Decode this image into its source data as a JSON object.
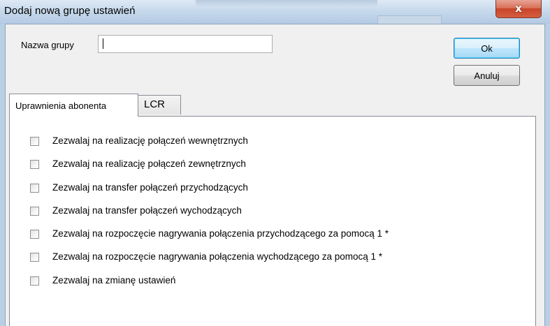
{
  "window": {
    "title": "Dodaj nową grupę ustawień",
    "close_symbol": "x"
  },
  "form": {
    "name_label": "Nazwa grupy",
    "name_value": "",
    "name_placeholder": ""
  },
  "buttons": {
    "ok_label": "Ok",
    "cancel_label": "Anuluj"
  },
  "tabs": [
    {
      "label": "Uprawnienia abonenta",
      "active": true
    },
    {
      "label": "LCR",
      "active": false
    }
  ],
  "permissions": [
    {
      "label": "Zezwalaj na realizację połączeń wewnętrznych",
      "checked": false
    },
    {
      "label": "Zezwalaj na realizację połączeń zewnętrznych",
      "checked": false
    },
    {
      "label": "Zezwalaj na transfer połączeń przychodzących",
      "checked": false
    },
    {
      "label": "Zezwalaj na transfer połączeń wychodzących",
      "checked": false
    },
    {
      "label": "Zezwalaj na rozpoczęcie nagrywania połączenia przychodzącego za pomocą 1 *",
      "checked": false
    },
    {
      "label": "Zezwalaj na rozpoczęcie nagrywania połączenia wychodzącego za pomocą 1 *",
      "checked": false
    },
    {
      "label": "Zezwalaj na zmianę ustawień",
      "checked": false
    }
  ],
  "colors": {
    "titlebar": "#c7d9ec",
    "close_button": "#c7462b",
    "dialog_background": "#f0f0f0",
    "default_button_border": "#3c7fb1"
  }
}
